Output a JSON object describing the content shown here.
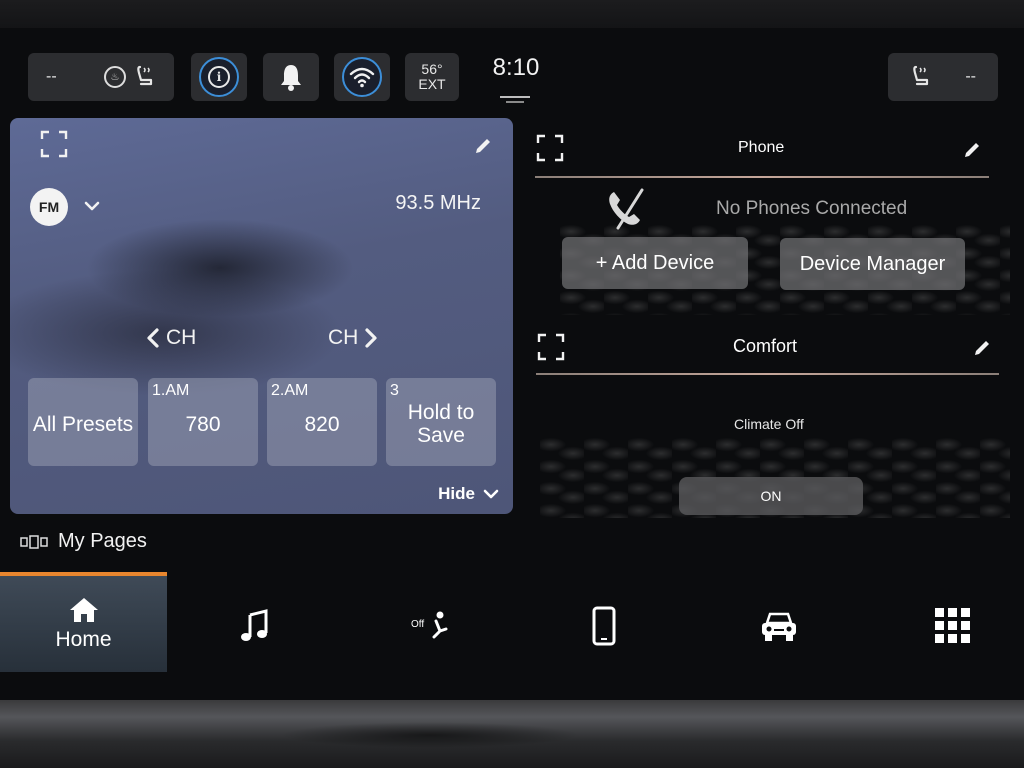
{
  "status_bar": {
    "left_seat_value": "--",
    "temperature": "56°",
    "temperature_label": "EXT",
    "time": "8:10",
    "right_seat_value": "--"
  },
  "radio": {
    "band": "FM",
    "frequency": "93.5 MHz",
    "ch_prev_label": "CH",
    "ch_next_label": "CH",
    "presets": [
      {
        "number": "",
        "value": "All Presets"
      },
      {
        "number": "1.AM",
        "value": "780"
      },
      {
        "number": "2.AM",
        "value": "820"
      },
      {
        "number": "3",
        "value": "Hold to Save"
      }
    ],
    "hide_label": "Hide"
  },
  "phone": {
    "title": "Phone",
    "message": "No Phones Connected",
    "add_device_label": "+ Add Device",
    "device_manager_label": "Device Manager"
  },
  "comfort": {
    "title": "Comfort",
    "status": "Climate Off",
    "on_label": "ON"
  },
  "my_pages_label": "My Pages",
  "nav": {
    "home_label": "Home",
    "climate_icon_text": "Off",
    "items": [
      "home-icon",
      "music-note-icon",
      "climate-off-icon",
      "phone-icon",
      "car-icon",
      "app-grid-icon"
    ]
  },
  "colors": {
    "accent": "#e8862e",
    "ring_blue": "#3c8ed8",
    "radio_card": "#5a6690"
  }
}
